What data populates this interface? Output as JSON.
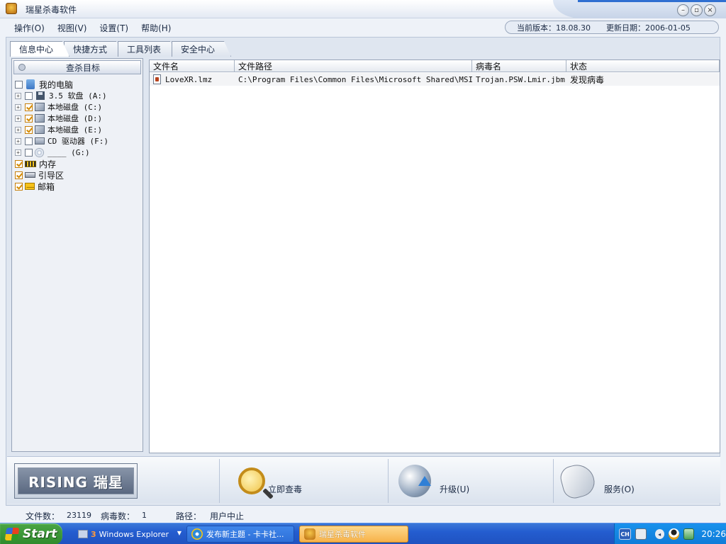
{
  "window": {
    "title": "瑞星杀毒软件",
    "buttons": [
      "–",
      "▫",
      "×"
    ]
  },
  "menu": {
    "items": [
      "操作(O)",
      "视图(V)",
      "设置(T)",
      "帮助(H)"
    ],
    "version_label": "当前版本：18.08.30",
    "update_label": "更新日期：2006-01-05"
  },
  "tabs": [
    "信息中心",
    "快捷方式",
    "工具列表",
    "安全中心"
  ],
  "left_panel": {
    "header": "查杀目标",
    "tree": [
      {
        "label": "我的电脑",
        "checked": false,
        "icon": "computer-icon"
      },
      {
        "label": "3.5 软盘 (A:)",
        "checked": false,
        "icon": "floppy-icon"
      },
      {
        "label": "本地磁盘 (C:)",
        "checked": true,
        "icon": "disk-icon"
      },
      {
        "label": "本地磁盘 (D:)",
        "checked": true,
        "icon": "disk-icon"
      },
      {
        "label": "本地磁盘 (E:)",
        "checked": true,
        "icon": "disk-icon"
      },
      {
        "label": "CD 驱动器 (F:)",
        "checked": false,
        "icon": "cd-drive-icon"
      },
      {
        "label": "____ (G:)",
        "checked": false,
        "icon": "cd-icon"
      },
      {
        "label": "内存",
        "checked": true,
        "icon": "memory-icon"
      },
      {
        "label": "引导区",
        "checked": true,
        "icon": "boot-sector-icon"
      },
      {
        "label": "邮箱",
        "checked": true,
        "icon": "mailbox-icon"
      }
    ]
  },
  "results": {
    "columns": [
      "文件名",
      "文件路径",
      "病毒名",
      "状态"
    ],
    "rows": [
      {
        "file": "LoveXR.lmz",
        "path": "C:\\Program Files\\Common Files\\Microsoft Shared\\MSInfo",
        "virus": "Trojan.PSW.Lmir.jbm",
        "status": "发现病毒"
      }
    ]
  },
  "actions": {
    "logo": "RISING 瑞星",
    "scan": "立即查毒",
    "upgrade": "升级(U)",
    "service": "服务(O)"
  },
  "status": {
    "files_label": "文件数：",
    "files_value": "23119",
    "virus_label": "病毒数：",
    "virus_value": "1",
    "path_label": "路径：",
    "path_value": "用户中止"
  },
  "taskbar": {
    "start": "Start",
    "group_count": "3",
    "group_label": "Windows Explorer",
    "ie_label": "发布新主题 - 卡卡社...",
    "app_label": "瑞星杀毒软件",
    "ime": "CH",
    "clock": "20:26"
  }
}
